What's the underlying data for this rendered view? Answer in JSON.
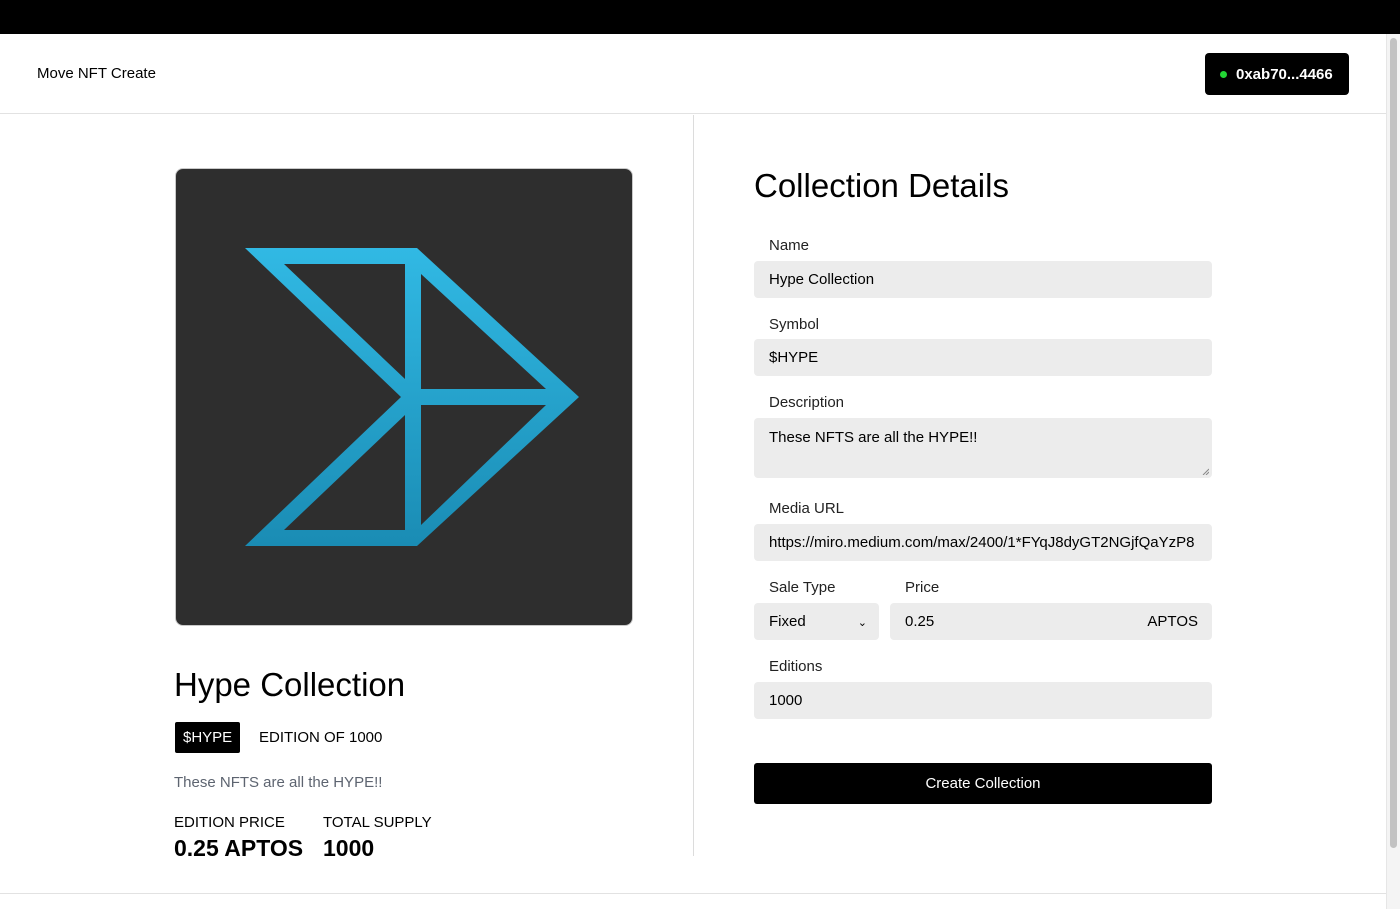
{
  "header": {
    "brand": "Move NFT Create",
    "wallet_address": "0xab70...4466",
    "status_color": "#22d534"
  },
  "preview": {
    "image_icon": "arrow-logo-icon",
    "accent_color": "#2bb3e0",
    "title": "Hype Collection",
    "symbol": "$HYPE",
    "edition_text": "EDITION OF 1000",
    "description": "These NFTS are all the HYPE!!",
    "edition_price_label": "EDITION PRICE",
    "edition_price_value": "0.25 APTOS",
    "total_supply_label": "TOTAL SUPPLY",
    "total_supply_value": "1000"
  },
  "form": {
    "title": "Collection Details",
    "name_label": "Name",
    "name_value": "Hype Collection",
    "symbol_label": "Symbol",
    "symbol_value": "$HYPE",
    "description_label": "Description",
    "description_value": "These NFTS are all the HYPE!!",
    "media_url_label": "Media URL",
    "media_url_value": "https://miro.medium.com/max/2400/1*FYqJ8dyGT2NGjfQaYzP8",
    "sale_type_label": "Sale Type",
    "sale_type_value": "Fixed",
    "price_label": "Price",
    "price_value": "0.25",
    "price_suffix": "APTOS",
    "editions_label": "Editions",
    "editions_value": "1000",
    "submit_label": "Create Collection"
  }
}
